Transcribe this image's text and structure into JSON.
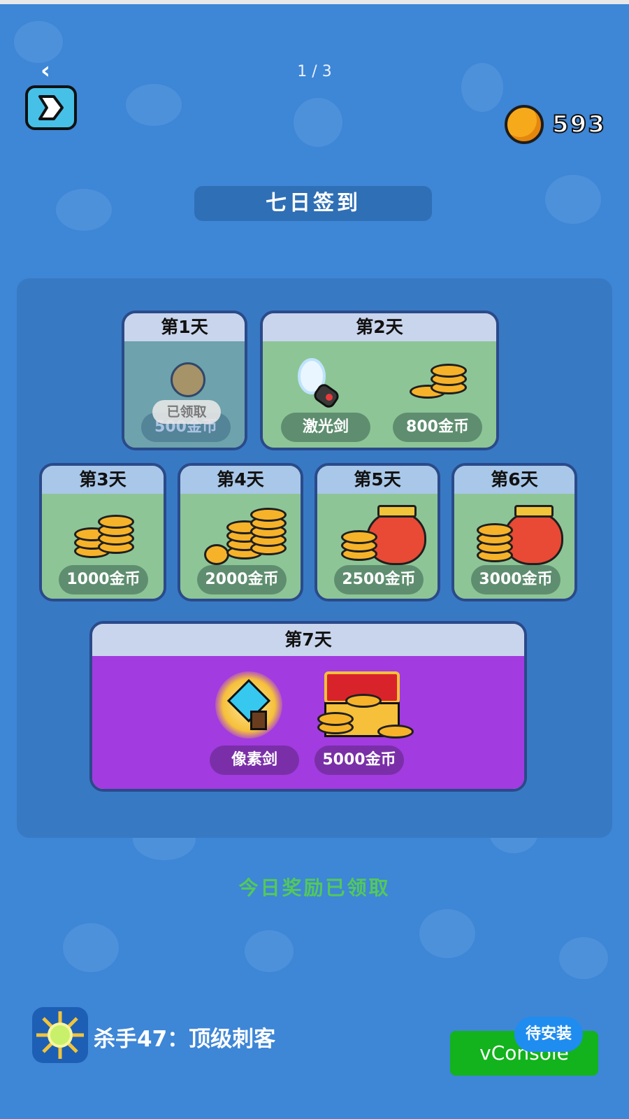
{
  "header": {
    "page_indicator": "1 / 3",
    "coin_balance": "593",
    "back_icon": "chevron-left-icon",
    "exit_icon": "exit-arrow-icon"
  },
  "title": "七日签到",
  "days": [
    {
      "label": "第1天",
      "rewards": [
        "500金币"
      ],
      "stamp": "已领取"
    },
    {
      "label": "第2天",
      "rewards": [
        "激光剑",
        "800金币"
      ]
    },
    {
      "label": "第3天",
      "rewards": [
        "1000金币"
      ]
    },
    {
      "label": "第4天",
      "rewards": [
        "2000金币"
      ]
    },
    {
      "label": "第5天",
      "rewards": [
        "2500金币"
      ]
    },
    {
      "label": "第6天",
      "rewards": [
        "3000金币"
      ]
    },
    {
      "label": "第7天",
      "rewards": [
        "像素剑",
        "5000金币"
      ]
    }
  ],
  "status": "今日奖励已领取",
  "footer": {
    "app_name": "杀手47：顶级刺客",
    "console_label": "vConsole",
    "install_badge": "待安装"
  },
  "colors": {
    "background": "#3e86d6",
    "status_green": "#52c95a",
    "day7_purple": "#a23be0",
    "console_green": "#12b31c",
    "install_blue": "#1f8cf0"
  }
}
